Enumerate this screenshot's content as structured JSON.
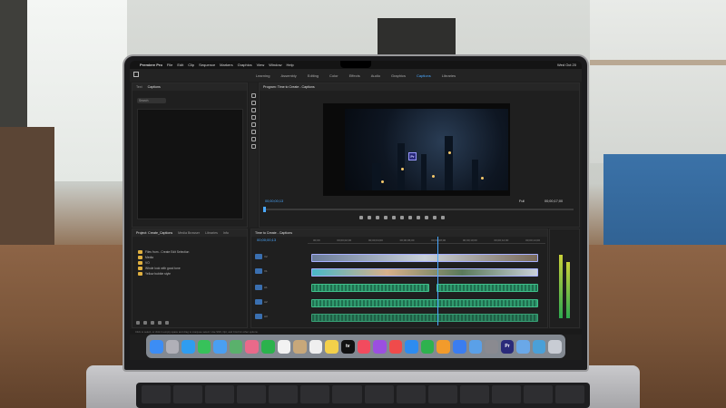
{
  "menubar": {
    "app_name": "Premiere Pro",
    "items": [
      "File",
      "Edit",
      "Clip",
      "Sequence",
      "Markers",
      "Graphics",
      "View",
      "Window",
      "Help"
    ],
    "clock": "Wed Oct 20"
  },
  "workspaces": {
    "items": [
      "Learning",
      "Assembly",
      "Editing",
      "Color",
      "Effects",
      "Audio",
      "Graphics",
      "Captions",
      "Libraries"
    ],
    "active": "Captions"
  },
  "captions_panel": {
    "tabs": [
      "Text",
      "Captions"
    ],
    "search_placeholder": "Search"
  },
  "program_panel": {
    "title": "Program: Time to Create - Captions",
    "timecode_in": "00;00;00;13",
    "timecode_out": "00;00;17;00",
    "fit_label": "Full",
    "badge": "Pr"
  },
  "project_panel": {
    "tabs": [
      "Project: Create_Captions",
      "Media Browser",
      "Libraries",
      "Info"
    ],
    "items": [
      "Files from - Create Edit Selection",
      "Media",
      "VO",
      "Whole look with good tone",
      "Yellow bubble style"
    ]
  },
  "timeline_panel": {
    "title": "Time to Create - Captions",
    "timecode": "00;00;00;13",
    "ruler": [
      "00;00",
      "00;00;02;00",
      "00;00;04;00",
      "00;00;06;00",
      "00;00;08;00",
      "00;00;10;00",
      "00;00;12;00",
      "00;00;14;00"
    ],
    "tracks": [
      "V2",
      "V1",
      "A1",
      "A2",
      "A3"
    ]
  },
  "statusbar": {
    "text": "Click to select, or click in empty space and drag to marquee select. Use Shift, Opt, and Cmd for other options."
  },
  "dock": {
    "apps": [
      {
        "name": "finder",
        "color": "#3c8df5",
        "label": ""
      },
      {
        "name": "launchpad",
        "color": "#b0b0b8",
        "label": ""
      },
      {
        "name": "safari",
        "color": "#2f9df0",
        "label": ""
      },
      {
        "name": "messages",
        "color": "#37c25a",
        "label": ""
      },
      {
        "name": "mail",
        "color": "#4a9ff2",
        "label": ""
      },
      {
        "name": "maps",
        "color": "#5ab16c",
        "label": ""
      },
      {
        "name": "photos",
        "color": "#e96a8a",
        "label": ""
      },
      {
        "name": "facetime",
        "color": "#2bb24c",
        "label": ""
      },
      {
        "name": "calendar",
        "color": "#f2f2f2",
        "label": ""
      },
      {
        "name": "contacts",
        "color": "#c8a87a",
        "label": ""
      },
      {
        "name": "reminders",
        "color": "#efefef",
        "label": ""
      },
      {
        "name": "notes",
        "color": "#f3d04a",
        "label": ""
      },
      {
        "name": "tv",
        "color": "#111111",
        "label": "tv"
      },
      {
        "name": "music",
        "color": "#f24b5e",
        "label": ""
      },
      {
        "name": "podcasts",
        "color": "#9b4fe0",
        "label": ""
      },
      {
        "name": "news",
        "color": "#f04b4b",
        "label": ""
      },
      {
        "name": "app-store",
        "color": "#2d8cf0",
        "label": ""
      },
      {
        "name": "numbers",
        "color": "#2eb24e",
        "label": ""
      },
      {
        "name": "pages",
        "color": "#f29b2b",
        "label": ""
      },
      {
        "name": "keynote",
        "color": "#3b7df0",
        "label": ""
      },
      {
        "name": "xcode",
        "color": "#5aa0e8",
        "label": ""
      },
      {
        "name": "system-preferences",
        "color": "#8a8a90",
        "label": ""
      },
      {
        "name": "premiere-pro",
        "color": "#2a2a7a",
        "label": "Pr"
      },
      {
        "name": "folder",
        "color": "#6aa8e8",
        "label": ""
      },
      {
        "name": "screen-recorder",
        "color": "#4aa0d8",
        "label": ""
      },
      {
        "name": "trash",
        "color": "#c8ccd4",
        "label": ""
      }
    ]
  },
  "colors": {
    "accent": "#4aa8ff",
    "video_clip_border": "#a6b0ff",
    "audio_clip": "#2f9a6e",
    "folder": "#e0b040"
  }
}
